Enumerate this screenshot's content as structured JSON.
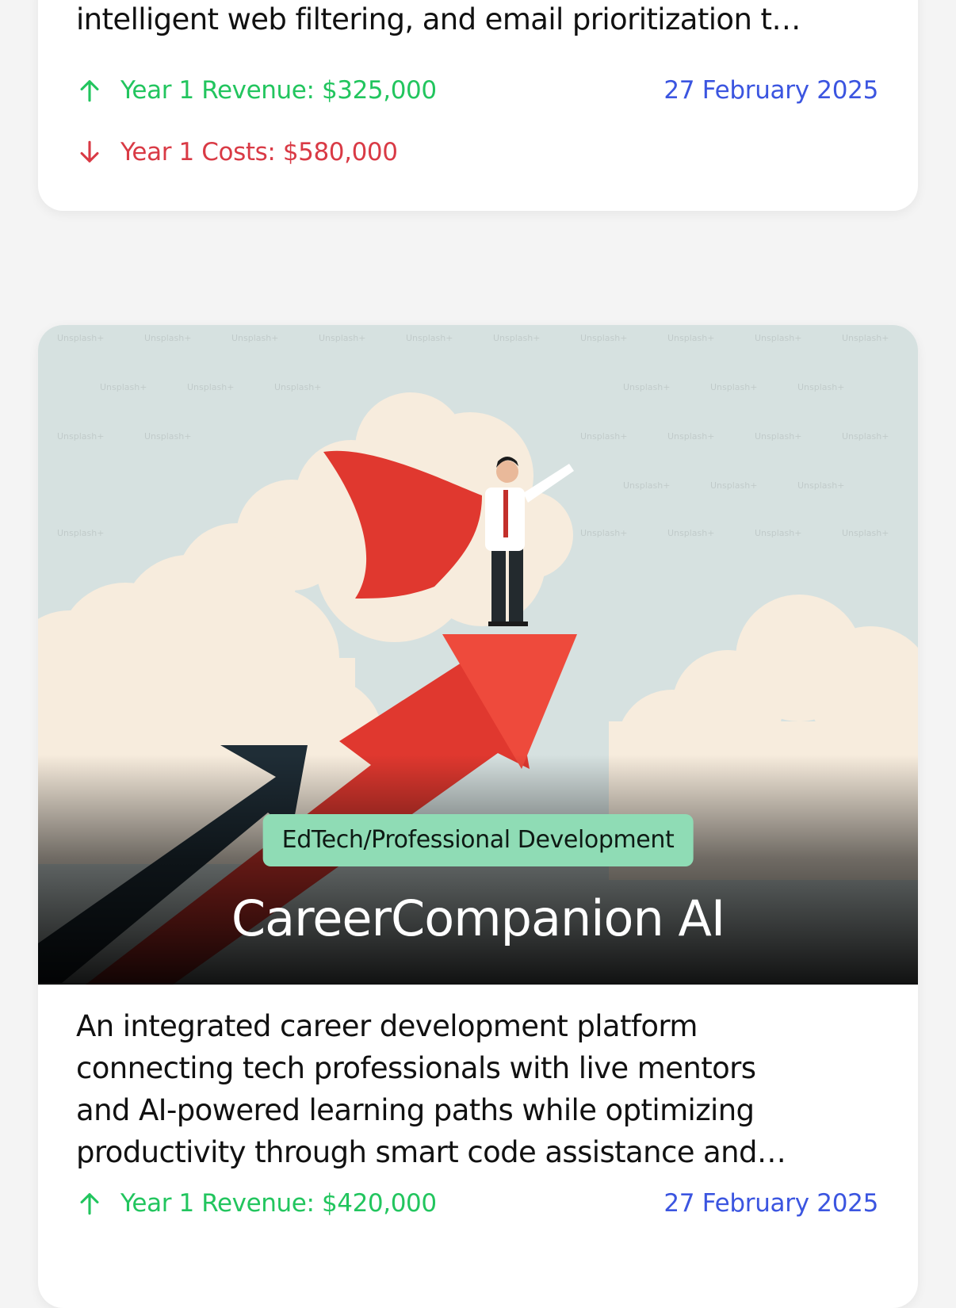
{
  "cards": [
    {
      "description_lines": [
        "intelligent web filtering, and email prioritization t…"
      ],
      "revenue": "Year 1 Revenue: $325,000",
      "costs": "Year 1 Costs: $580,000",
      "date": "27 February 2025"
    },
    {
      "category": "EdTech/Professional Development",
      "title": "CareerCompanion AI",
      "image_watermark": "Unsplash+",
      "description_lines": [
        "An integrated career development platform",
        "connecting tech professionals with live mentors",
        "and AI-powered learning paths while optimizing",
        "productivity through smart code assistance and…"
      ],
      "revenue": "Year 1 Revenue: $420,000",
      "date": "27 February 2025"
    }
  ],
  "colors": {
    "revenue": "#22c55e",
    "costs": "#d93a45",
    "date": "#3b55e0",
    "tag_bg": "#8fdcb5"
  },
  "icons": {
    "revenue": "arrow-up-icon",
    "costs": "arrow-down-icon"
  }
}
